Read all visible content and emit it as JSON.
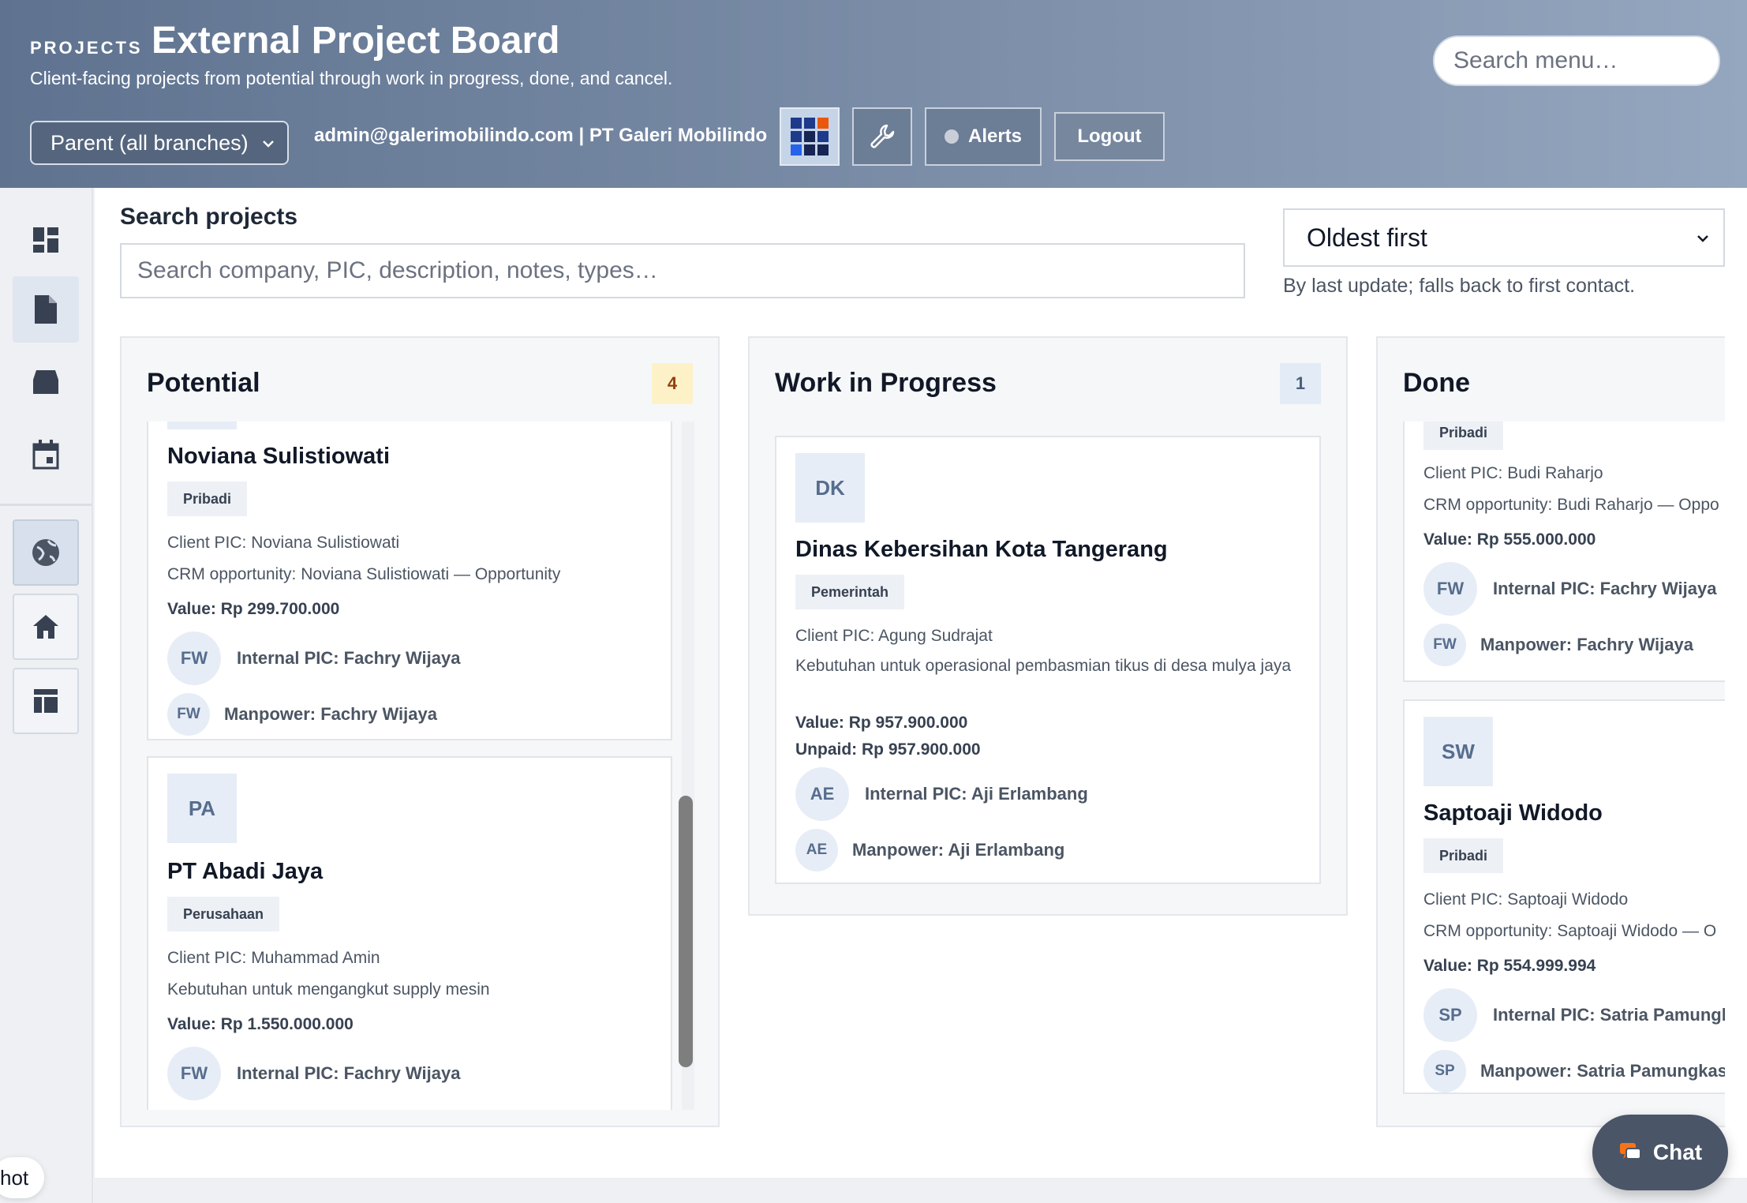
{
  "header": {
    "kicker": "PROJECTS",
    "title": "External Project Board",
    "subtitle": "Client-facing projects from potential through work in progress, done, and cancel.",
    "search_placeholder": "Search menu…",
    "branch_selected": "Parent (all branches)",
    "user": "admin@galerimobilindo.com | PT Galeri Mobilindo",
    "alerts_label": "Alerts",
    "logout_label": "Logout",
    "icons": [
      "apps-grid-icon",
      "wrench-icon",
      "status-dot-icon"
    ]
  },
  "sidebar": {
    "items": [
      "dashboard-icon",
      "document-icon",
      "inbox-icon",
      "calendar-icon",
      "globe-icon",
      "home-icon",
      "layout-icon"
    ],
    "active": [
      "document-icon",
      "globe-icon"
    ]
  },
  "filters": {
    "search_label": "Search projects",
    "search_placeholder": "Search company, PIC, description, notes, types…",
    "sort_selected": "Oldest first",
    "sort_help": "By last update; falls back to first contact."
  },
  "columns": [
    {
      "title": "Potential",
      "count": "4",
      "cards": [
        {
          "name": "Noviana Sulistiowati",
          "tag": "Pribadi",
          "client_pic": "Client PIC: Noviana Sulistiowati",
          "note": "CRM opportunity: Noviana Sulistiowati — Opportunity",
          "value": "Value: Rp 299.700.000",
          "internal_initials": "FW",
          "internal_pic": "Internal PIC: Fachry Wijaya",
          "manpower_initials": "FW",
          "manpower": "Manpower: Fachry Wijaya"
        },
        {
          "initials": "PA",
          "name": "PT Abadi Jaya",
          "tag": "Perusahaan",
          "client_pic": "Client PIC: Muhammad Amin",
          "note": "Kebutuhan untuk mengangkut supply mesin",
          "value": "Value: Rp 1.550.000.000",
          "internal_initials": "FW",
          "internal_pic": "Internal PIC: Fachry Wijaya"
        }
      ]
    },
    {
      "title": "Work in Progress",
      "count": "1",
      "cards": [
        {
          "initials": "DK",
          "name": "Dinas Kebersihan Kota Tangerang",
          "tag": "Pemerintah",
          "client_pic": "Client PIC: Agung Sudrajat",
          "note": "Kebutuhan untuk operasional pembasmian tikus di desa mulya jaya",
          "value": "Value: Rp 957.900.000",
          "unpaid": "Unpaid: Rp 957.900.000",
          "internal_initials": "AE",
          "internal_pic": "Internal PIC: Aji Erlambang",
          "manpower_initials": "AE",
          "manpower": "Manpower: Aji Erlambang"
        }
      ]
    },
    {
      "title": "Done",
      "cards": [
        {
          "tag": "Pribadi",
          "client_pic": "Client PIC: Budi Raharjo",
          "note": "CRM opportunity: Budi Raharjo — Oppo",
          "value": "Value: Rp 555.000.000",
          "internal_initials": "FW",
          "internal_pic": "Internal PIC: Fachry Wijaya",
          "manpower_initials": "FW",
          "manpower": "Manpower: Fachry Wijaya"
        },
        {
          "initials": "SW",
          "name": "Saptoaji Widodo",
          "tag": "Pribadi",
          "client_pic": "Client PIC: Saptoaji Widodo",
          "note": "CRM opportunity: Saptoaji Widodo — O",
          "value": "Value: Rp 554.999.994",
          "internal_initials": "SP",
          "internal_pic": "Internal PIC: Satria Pamungk",
          "manpower_initials": "SP",
          "manpower": "Manpower: Satria Pamungkas"
        }
      ]
    }
  ],
  "hot_tab": "hot",
  "chat": {
    "label": "Chat",
    "icon": "chat-bubble-icon"
  },
  "colors": {
    "header_start": "#5f7390",
    "header_end": "#95a6bf",
    "count_amber": "#fdf1c8",
    "chat_bg": "#4a5568"
  }
}
